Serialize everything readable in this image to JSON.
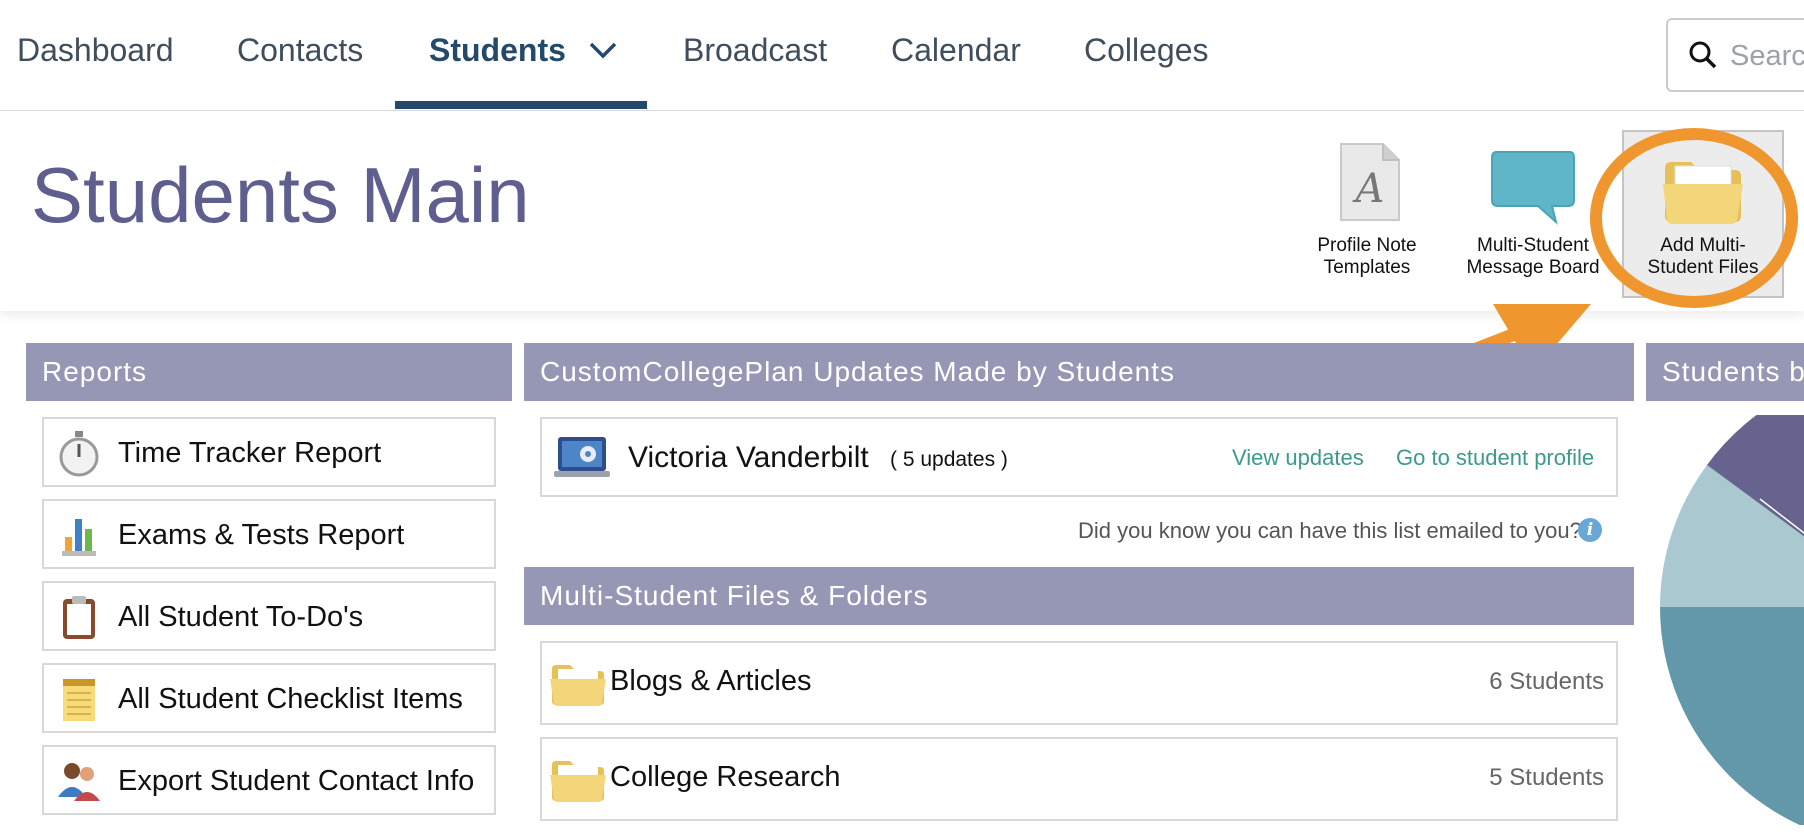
{
  "nav": {
    "items": [
      "Dashboard",
      "Contacts",
      "Students",
      "Broadcast",
      "Calendar",
      "Colleges"
    ],
    "active": "Students",
    "search_placeholder": "Search"
  },
  "page": {
    "title": "Students Main"
  },
  "toolbar": {
    "profile_note_line1": "Profile Note",
    "profile_note_line2": "Templates",
    "message_board_line1": "Multi-Student",
    "message_board_line2": "Message Board",
    "add_files_line1": "Add Multi-",
    "add_files_line2": "Student Files"
  },
  "annotation": {
    "color": "#f0962f"
  },
  "reports": {
    "title": "Reports",
    "items": [
      {
        "label": "Time Tracker Report",
        "icon": "stopwatch-icon"
      },
      {
        "label": "Exams & Tests Report",
        "icon": "bar-chart-icon"
      },
      {
        "label": "All Student To-Do's",
        "icon": "clipboard-icon"
      },
      {
        "label": "All Student Checklist Items",
        "icon": "notepad-icon"
      },
      {
        "label": "Export Student Contact Info",
        "icon": "people-icon"
      }
    ]
  },
  "updates": {
    "title": "CustomCollegePlan Updates Made by Students",
    "student": "Victoria Vanderbilt",
    "count": "( 5 updates )",
    "view_link": "View updates",
    "profile_link": "Go to student profile",
    "hint": "Did you know you can have this list emailed to you?"
  },
  "files": {
    "title": "Multi-Student Files & Folders",
    "folders": [
      {
        "name": "Blogs & Articles",
        "count": "6 Students"
      },
      {
        "name": "College Research",
        "count": "5 Students"
      }
    ]
  },
  "students_by": {
    "title": "Students b"
  },
  "colors": {
    "header": "#9597b5",
    "nav_active": "#234a6a",
    "title": "#5e5e8f",
    "link": "#3b9a8c"
  }
}
